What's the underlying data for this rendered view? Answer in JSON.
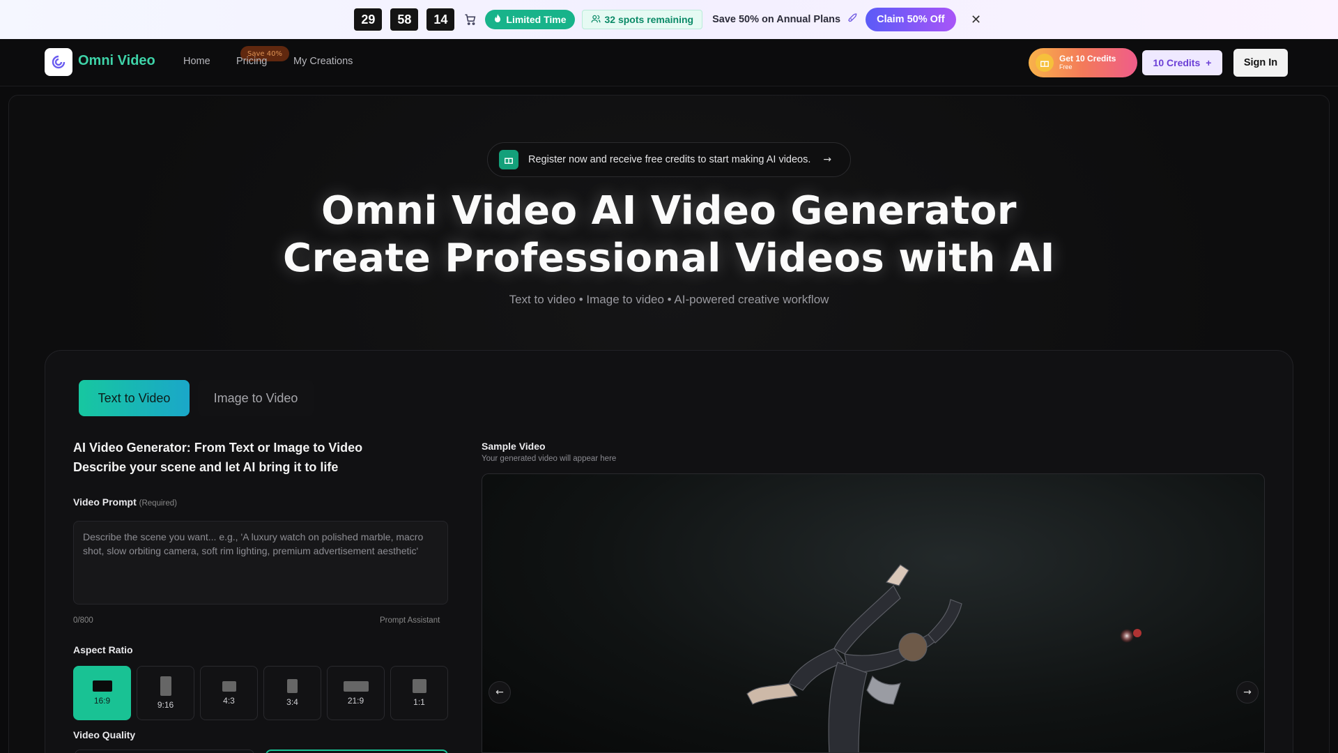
{
  "promo": {
    "countdown": [
      "29",
      "58",
      "14"
    ],
    "limited_label": "Limited Time",
    "spots_label": "32 spots remaining",
    "save_text": "Save 50% on Annual Plans",
    "claim_label": "Claim 50% Off"
  },
  "nav": {
    "brand": "Omni Video",
    "links": [
      "Home",
      "Pricing",
      "My Creations"
    ],
    "pricing_badge": "Save 40%",
    "get_credits_title": "Get 10 Credits",
    "get_credits_sub": "Free",
    "credits_label": "10 Credits",
    "signin_label": "Sign In"
  },
  "hero": {
    "register_text": "Register now and receive free credits to start making AI videos.",
    "title_line1": "Omni Video AI Video Generator",
    "title_line2": "Create Professional Videos with AI",
    "subtitle": "Text to video • Image to video • AI-powered creative workflow"
  },
  "tabs": [
    "Text to Video",
    "Image to Video"
  ],
  "form": {
    "heading_line1": "AI Video Generator: From Text or Image to Video",
    "heading_line2": "Describe your scene and let AI bring it to life",
    "prompt_label": "Video Prompt",
    "prompt_required": "(Required)",
    "prompt_placeholder": "Describe the scene you want... e.g., 'A luxury watch on polished marble, macro shot, slow orbiting camera, soft rim lighting, premium advertisement aesthetic'",
    "counter": "0/800",
    "assistant": "Prompt Assistant",
    "aspect_label": "Aspect Ratio",
    "ratios": [
      "16:9",
      "9:16",
      "4:3",
      "3:4",
      "21:9",
      "1:1"
    ],
    "selected_ratio": "16:9",
    "quality_label": "Video Quality"
  },
  "sample": {
    "title": "Sample Video",
    "subtitle": "Your generated video will appear here"
  },
  "colors": {
    "accent": "#19c294",
    "brand": "#3ed3a8",
    "claim_start": "#5b5bf7",
    "claim_end": "#a855f7"
  }
}
